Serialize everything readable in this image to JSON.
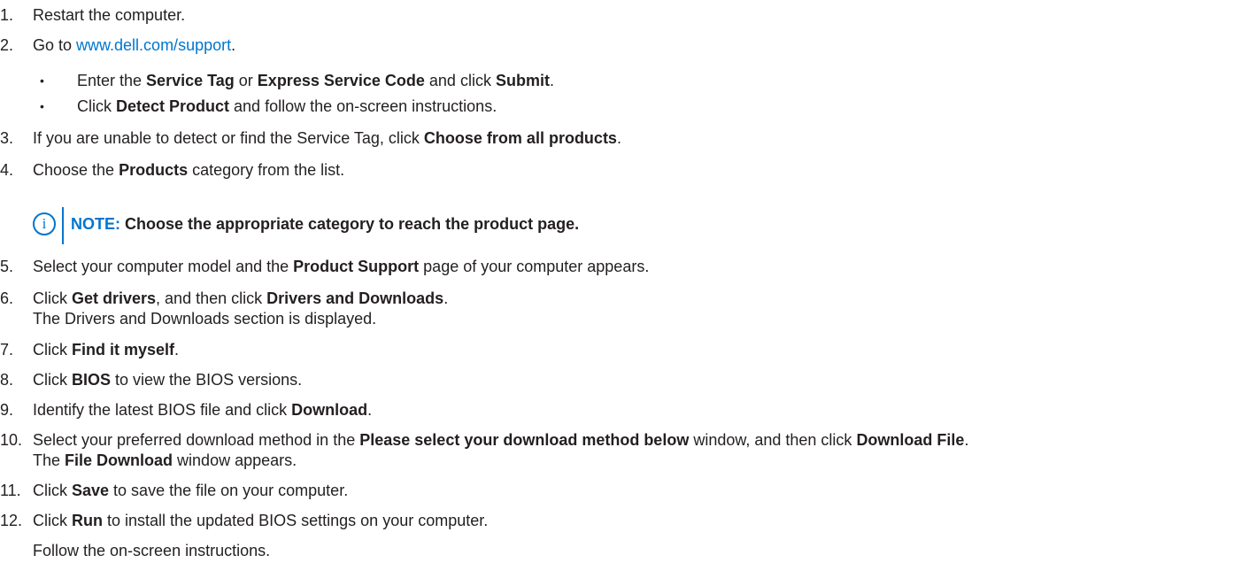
{
  "steps": [
    {
      "num": "1.",
      "text": "Restart the computer."
    },
    {
      "num": "2.",
      "pre": "Go to ",
      "link": "www.dell.com/support",
      "post": "."
    },
    {
      "num": "3.",
      "pre": "If you are unable to detect or find the Service Tag, click ",
      "bold": "Choose from all products",
      "post": "."
    },
    {
      "num": "4.",
      "pre": "Choose the ",
      "bold": "Products",
      "post": " category from the list."
    },
    {
      "num": "5.",
      "pre": "Select your computer model and the ",
      "bold": "Product Support",
      "post": " page of your computer appears."
    },
    {
      "num": "6.",
      "pre": "Click ",
      "bold": "Get drivers",
      "mid": ", and then click ",
      "bold2": "Drivers and Downloads",
      "post": ".",
      "line2": "The Drivers and Downloads section is displayed."
    },
    {
      "num": "7.",
      "pre": "Click ",
      "bold": "Find it myself",
      "post": "."
    },
    {
      "num": "8.",
      "pre": "Click ",
      "bold": "BIOS",
      "post": " to view the BIOS versions."
    },
    {
      "num": "9.",
      "pre": "Identify the latest BIOS file and click ",
      "bold": "Download",
      "post": "."
    },
    {
      "num": "10.",
      "pre": "Select your preferred download method in the ",
      "bold": "Please select your download method below",
      "mid": " window, and then click ",
      "bold2": "Download File",
      "post": ".",
      "line2_pre": "The ",
      "line2_bold": "File Download",
      "line2_post": " window appears."
    },
    {
      "num": "11.",
      "pre": "Click ",
      "bold": "Save",
      "post": " to save the file on your computer."
    },
    {
      "num": "12.",
      "pre": "Click ",
      "bold": "Run",
      "post": " to install the updated BIOS settings on your computer."
    }
  ],
  "substeps": [
    {
      "bullet": "•",
      "pre": "Enter the ",
      "bold": "Service Tag",
      "mid": " or ",
      "bold2": "Express Service Code",
      "mid2": " and click ",
      "bold3": "Submit",
      "post": "."
    },
    {
      "bullet": "•",
      "pre": "Click ",
      "bold": "Detect Product",
      "post": " and follow the on-screen instructions."
    }
  ],
  "note": {
    "icon": "info-icon",
    "label": "NOTE:",
    "text": " Choose the appropriate category to reach the product page."
  },
  "footer": "Follow the on-screen instructions.",
  "colors": {
    "accent": "#0076ce",
    "text": "#231f20"
  }
}
